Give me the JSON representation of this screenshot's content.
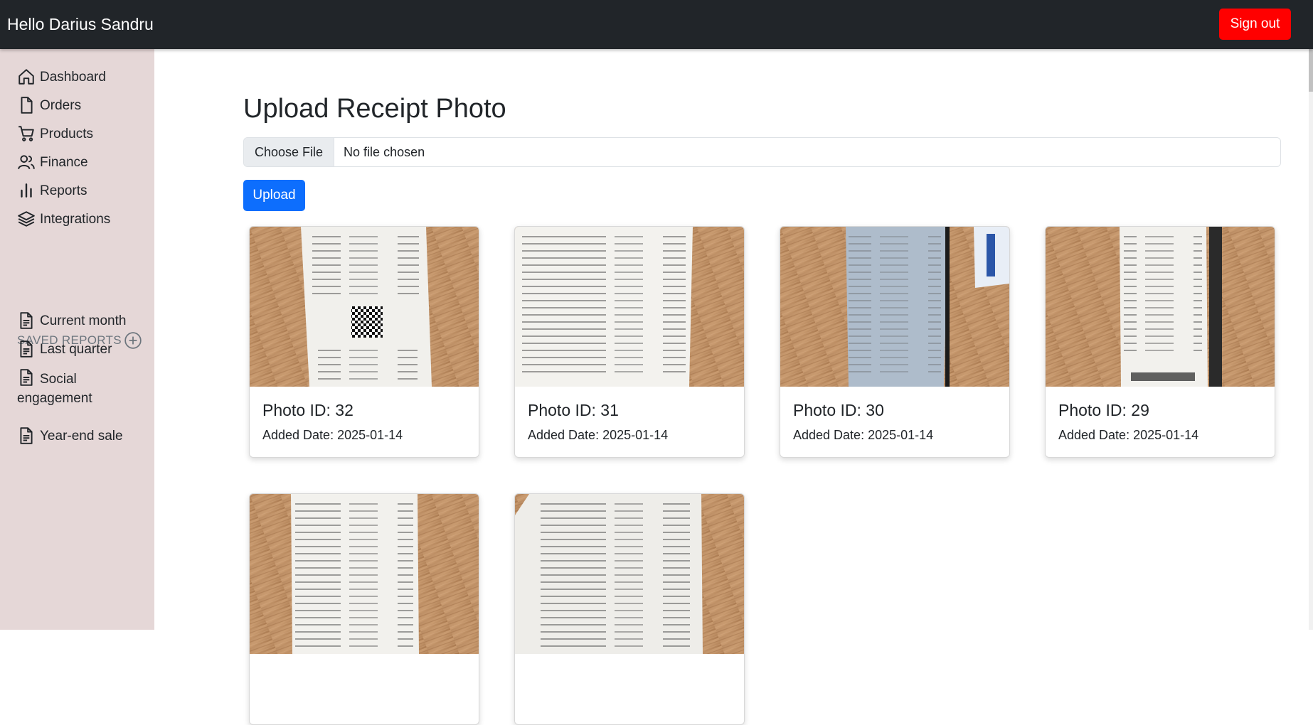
{
  "header": {
    "greeting": "Hello Darius Sandru",
    "signout_label": "Sign out",
    "signout_color": "#ff0000"
  },
  "sidebar": {
    "items": [
      {
        "label": "Dashboard",
        "icon": "home-icon"
      },
      {
        "label": "Orders",
        "icon": "file-icon"
      },
      {
        "label": "Products",
        "icon": "cart-icon"
      },
      {
        "label": "Finance",
        "icon": "users-icon"
      },
      {
        "label": "Reports",
        "icon": "bar-chart-icon"
      },
      {
        "label": "Integrations",
        "icon": "layers-icon"
      }
    ],
    "saved_heading": "SAVED REPORTS",
    "saved_reports": [
      {
        "label": "Current month",
        "icon": "document-icon"
      },
      {
        "label": "Last quarter",
        "icon": "document-icon"
      },
      {
        "label": "Social engagement",
        "icon": "document-icon"
      },
      {
        "label": "Year-end sale",
        "icon": "document-icon"
      }
    ]
  },
  "main": {
    "title": "Upload Receipt Photo",
    "file_button": "Choose File",
    "file_status": "No file chosen",
    "upload_label": "Upload",
    "upload_color": "#0d6efd",
    "photos": [
      {
        "title": "Photo ID: 32",
        "date": "Added Date: 2025-01-14"
      },
      {
        "title": "Photo ID: 31",
        "date": "Added Date: 2025-01-14"
      },
      {
        "title": "Photo ID: 30",
        "date": "Added Date: 2025-01-14"
      },
      {
        "title": "Photo ID: 29",
        "date": "Added Date: 2025-01-14"
      },
      {
        "title": "",
        "date": ""
      },
      {
        "title": "",
        "date": ""
      }
    ]
  }
}
